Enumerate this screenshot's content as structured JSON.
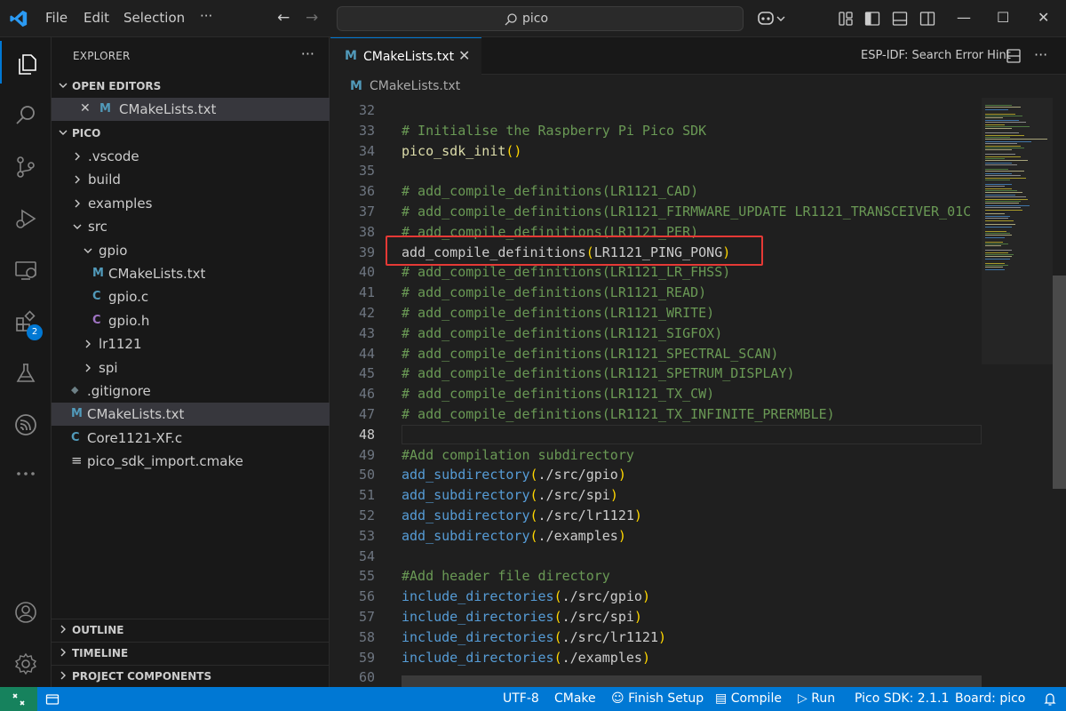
{
  "titlebar": {
    "menu": [
      "File",
      "Edit",
      "Selection"
    ],
    "more": "···",
    "search_text": "pico"
  },
  "window_controls": {
    "minimize": "—",
    "maximize": "☐",
    "close": "✕"
  },
  "activitybar": {
    "extensions_badge": "2"
  },
  "sidebar": {
    "title": "EXPLORER",
    "dots": "···",
    "open_editors": {
      "label": "OPEN EDITORS",
      "items": [
        {
          "name": "CMakeLists.txt"
        }
      ]
    },
    "workspace": "PICO",
    "tree": [
      {
        "name": ".vscode",
        "type": "folder",
        "depth": 0,
        "expanded": false
      },
      {
        "name": "build",
        "type": "folder",
        "depth": 0,
        "expanded": false
      },
      {
        "name": "examples",
        "type": "folder",
        "depth": 0,
        "expanded": false
      },
      {
        "name": "src",
        "type": "folder",
        "depth": 0,
        "expanded": true
      },
      {
        "name": "gpio",
        "type": "folder",
        "depth": 1,
        "expanded": true
      },
      {
        "name": "CMakeLists.txt",
        "type": "cmake",
        "depth": 2
      },
      {
        "name": "gpio.c",
        "type": "c",
        "depth": 2
      },
      {
        "name": "gpio.h",
        "type": "h",
        "depth": 2
      },
      {
        "name": "lr1121",
        "type": "folder",
        "depth": 1,
        "expanded": false
      },
      {
        "name": "spi",
        "type": "folder",
        "depth": 1,
        "expanded": false
      },
      {
        "name": ".gitignore",
        "type": "git",
        "depth": 0
      },
      {
        "name": "CMakeLists.txt",
        "type": "cmake",
        "depth": 0,
        "selected": true
      },
      {
        "name": "Core1121-XF.c",
        "type": "c",
        "depth": 0
      },
      {
        "name": "pico_sdk_import.cmake",
        "type": "file",
        "depth": 0
      }
    ],
    "bottom_sections": [
      "OUTLINE",
      "TIMELINE",
      "PROJECT COMPONENTS"
    ]
  },
  "tabs": {
    "active": {
      "icon": "M",
      "label": "CMakeLists.txt",
      "close": "✕"
    },
    "right_text": "ESP-IDF: Search Error Hint",
    "more": "···"
  },
  "breadcrumb": {
    "icon": "M",
    "file": "CMakeLists.txt"
  },
  "editor": {
    "current_line": 48,
    "lines": [
      {
        "n": 32,
        "parts": []
      },
      {
        "n": 33,
        "parts": [
          [
            "c-cmt",
            "# Initialise the Raspberry Pi Pico SDK"
          ]
        ]
      },
      {
        "n": 34,
        "parts": [
          [
            "c-fn",
            "pico_sdk_init"
          ],
          [
            "c-par",
            "()"
          ]
        ]
      },
      {
        "n": 35,
        "parts": []
      },
      {
        "n": 36,
        "parts": [
          [
            "c-cmt",
            "# add_compile_definitions(LR1121_CAD)"
          ]
        ]
      },
      {
        "n": 37,
        "parts": [
          [
            "c-cmt",
            "# add_compile_definitions(LR1121_FIRMWARE_UPDATE LR1121_TRANSCEIVER_01C"
          ]
        ]
      },
      {
        "n": 38,
        "parts": [
          [
            "c-cmt",
            "# add_compile_definitions(LR1121_PER)"
          ]
        ]
      },
      {
        "n": 39,
        "parts": [
          [
            "c-txt",
            "add_compile_definitions"
          ],
          [
            "c-par",
            "("
          ],
          [
            "c-txt",
            "LR1121_PING_PONG"
          ],
          [
            "c-par",
            ")"
          ]
        ]
      },
      {
        "n": 40,
        "parts": [
          [
            "c-cmt",
            "# add_compile_definitions(LR1121_LR_FHSS)"
          ]
        ]
      },
      {
        "n": 41,
        "parts": [
          [
            "c-cmt",
            "# add_compile_definitions(LR1121_READ)"
          ]
        ]
      },
      {
        "n": 42,
        "parts": [
          [
            "c-cmt",
            "# add_compile_definitions(LR1121_WRITE)"
          ]
        ]
      },
      {
        "n": 43,
        "parts": [
          [
            "c-cmt",
            "# add_compile_definitions(LR1121_SIGFOX)"
          ]
        ]
      },
      {
        "n": 44,
        "parts": [
          [
            "c-cmt",
            "# add_compile_definitions(LR1121_SPECTRAL_SCAN)"
          ]
        ]
      },
      {
        "n": 45,
        "parts": [
          [
            "c-cmt",
            "# add_compile_definitions(LR1121_SPETRUM_DISPLAY)"
          ]
        ]
      },
      {
        "n": 46,
        "parts": [
          [
            "c-cmt",
            "# add_compile_definitions(LR1121_TX_CW)"
          ]
        ]
      },
      {
        "n": 47,
        "parts": [
          [
            "c-cmt",
            "# add_compile_definitions(LR1121_TX_INFINITE_PRERMBLE)"
          ]
        ]
      },
      {
        "n": 48,
        "parts": []
      },
      {
        "n": 49,
        "parts": [
          [
            "c-cmt",
            "#Add compilation subdirectory"
          ]
        ]
      },
      {
        "n": 50,
        "parts": [
          [
            "c-kw",
            "add_subdirectory"
          ],
          [
            "c-par",
            "("
          ],
          [
            "c-txt",
            "./src/gpio"
          ],
          [
            "c-par",
            ")"
          ]
        ]
      },
      {
        "n": 51,
        "parts": [
          [
            "c-kw",
            "add_subdirectory"
          ],
          [
            "c-par",
            "("
          ],
          [
            "c-txt",
            "./src/spi"
          ],
          [
            "c-par",
            ")"
          ]
        ]
      },
      {
        "n": 52,
        "parts": [
          [
            "c-kw",
            "add_subdirectory"
          ],
          [
            "c-par",
            "("
          ],
          [
            "c-txt",
            "./src/lr1121"
          ],
          [
            "c-par",
            ")"
          ]
        ]
      },
      {
        "n": 53,
        "parts": [
          [
            "c-kw",
            "add_subdirectory"
          ],
          [
            "c-par",
            "("
          ],
          [
            "c-txt",
            "./examples"
          ],
          [
            "c-par",
            ")"
          ]
        ]
      },
      {
        "n": 54,
        "parts": []
      },
      {
        "n": 55,
        "parts": [
          [
            "c-cmt",
            "#Add header file directory"
          ]
        ]
      },
      {
        "n": 56,
        "parts": [
          [
            "c-kw",
            "include_directories"
          ],
          [
            "c-par",
            "("
          ],
          [
            "c-txt",
            "./src/gpio"
          ],
          [
            "c-par",
            ")"
          ]
        ]
      },
      {
        "n": 57,
        "parts": [
          [
            "c-kw",
            "include_directories"
          ],
          [
            "c-par",
            "("
          ],
          [
            "c-txt",
            "./src/spi"
          ],
          [
            "c-par",
            ")"
          ]
        ]
      },
      {
        "n": 58,
        "parts": [
          [
            "c-kw",
            "include_directories"
          ],
          [
            "c-par",
            "("
          ],
          [
            "c-txt",
            "./src/lr1121"
          ],
          [
            "c-par",
            ")"
          ]
        ]
      },
      {
        "n": 59,
        "parts": [
          [
            "c-kw",
            "include_directories"
          ],
          [
            "c-par",
            "("
          ],
          [
            "c-txt",
            "./examples"
          ],
          [
            "c-par",
            ")"
          ]
        ]
      },
      {
        "n": 60,
        "parts": []
      }
    ]
  },
  "statusbar": {
    "encoding": "UTF-8",
    "language": "CMake",
    "finish_setup": "Finish Setup",
    "compile": "Compile",
    "run": "Run",
    "sdk": "Pico SDK: 2.1.1",
    "board": "Board: pico"
  },
  "colors": {
    "accent": "#0078d4",
    "comment": "#6a9955",
    "function": "#dcdcaa",
    "keyword": "#569cd6",
    "highlight_box": "#e53935",
    "cmake_icon": "#519aba",
    "c_icon": "#519aba",
    "h_icon": "#a074c4"
  }
}
